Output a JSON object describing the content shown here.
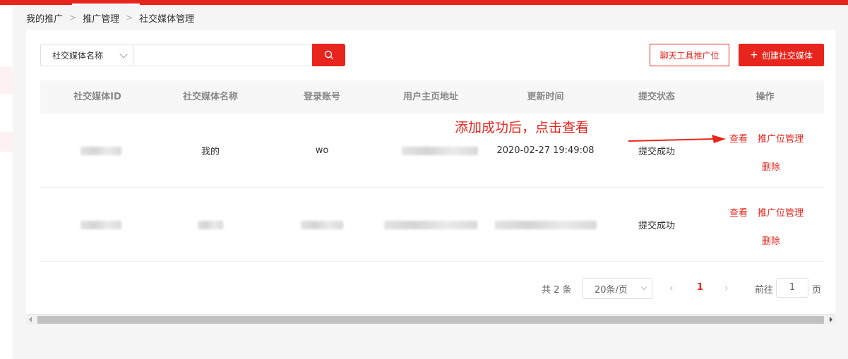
{
  "breadcrumb": [
    "我的推广",
    "推广管理",
    "社交媒体管理"
  ],
  "search": {
    "select_value": "社交媒体名称",
    "input_value": "",
    "search_icon": "search-icon"
  },
  "toolbar": {
    "chat_tool_button": "聊天工具推广位",
    "create_button_plus": "+",
    "create_button": "创建社交媒体"
  },
  "table": {
    "headers": [
      "社交媒体ID",
      "社交媒体名称",
      "登录账号",
      "用户主页地址",
      "更新时间",
      "提交状态",
      "操作"
    ],
    "rows": [
      {
        "id": "",
        "name": "我的",
        "account": "wo",
        "homepage": "",
        "updated": "2020-02-27 19:49:08",
        "status": "提交成功",
        "actions": [
          "查看",
          "推广位管理",
          "删除"
        ]
      },
      {
        "id": "",
        "name": "",
        "account": "",
        "homepage": "",
        "updated": "",
        "status": "提交成功",
        "actions": [
          "查看",
          "推广位管理",
          "删除"
        ]
      }
    ]
  },
  "annotation": "添加成功后，点击查看",
  "pagination": {
    "total": "共 2 条",
    "page_size": "20条/页",
    "current_page": "1",
    "goto_label": "前往",
    "goto_value": "1",
    "page_suffix": "页"
  },
  "colors": {
    "accent": "#e8251d",
    "header_bg": "#f7f7f7",
    "page_bg": "#f5f5f5"
  }
}
